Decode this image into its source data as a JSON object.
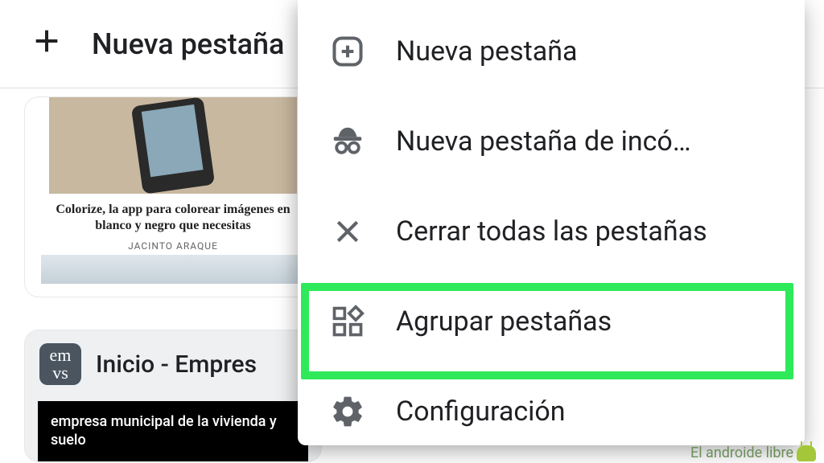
{
  "topbar": {
    "title": "Nueva pestaña"
  },
  "card1": {
    "title": "Colorize, la app para colorear imágenes en blanco y negro que necesitas",
    "author": "JACINTO ARAQUE"
  },
  "card2": {
    "favicon_text_top": "em",
    "favicon_text_bottom": "vs",
    "title": "Inicio - Empres",
    "black_text": "empresa municipal de la vivienda y suelo"
  },
  "menu": {
    "new_tab": "Nueva pestaña",
    "incognito": "Nueva pestaña de incó…",
    "close_all": "Cerrar todas las pestañas",
    "group_tabs": "Agrupar pestañas",
    "settings": "Configuración"
  },
  "watermark": "El androide libre"
}
